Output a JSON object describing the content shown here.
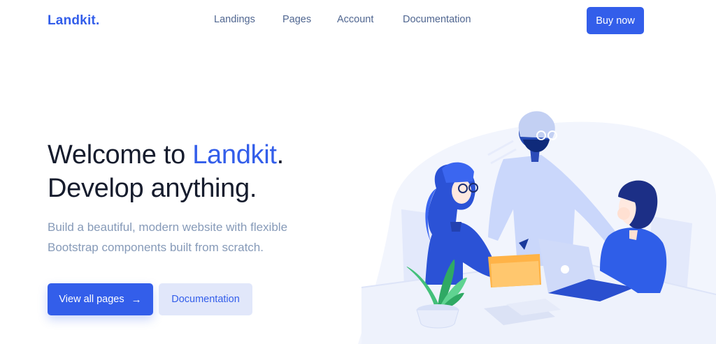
{
  "brand": {
    "logo": "Landkit."
  },
  "nav": {
    "items": [
      {
        "label": "Landings"
      },
      {
        "label": "Pages"
      },
      {
        "label": "Account"
      },
      {
        "label": "Documentation"
      }
    ],
    "cta": "Buy now"
  },
  "hero": {
    "title_prefix": "Welcome to ",
    "title_accent": "Landkit",
    "title_suffix": ".",
    "title_line2": "Develop anything.",
    "subtitle": "Build a beautiful, modern website with flexible Bootstrap components built from scratch.",
    "primary_button": "View all pages",
    "primary_icon": "arrow-right-icon",
    "secondary_button": "Documentation"
  },
  "colors": {
    "primary": "#335eea",
    "heading": "#161c2d",
    "muted": "#869ab8",
    "nav_text": "#506690",
    "secondary_bg": "#e1e7fa"
  }
}
